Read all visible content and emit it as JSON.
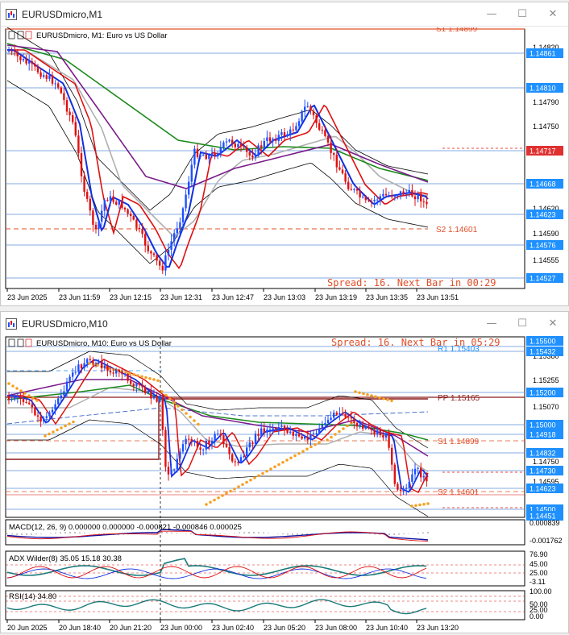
{
  "windows": [
    {
      "title": "EURUSDmicro,M1",
      "header": "EURUSDmicro, M1:  Euro vs US Dollar",
      "spread": "Spread: 16. Next Bar in 00:29",
      "price_labels": [
        "1.14820",
        "1.14790",
        "1.14750",
        "1.14717",
        "1.14620",
        "1.14590",
        "1.14555"
      ],
      "price_boxes": [
        {
          "text": "1.14861",
          "color": "#1e90ff"
        },
        {
          "text": "1.14810",
          "color": "#1e90ff"
        },
        {
          "text": "1.14717",
          "color": "#e03030"
        },
        {
          "text": "1.14668",
          "color": "#1e90ff"
        },
        {
          "text": "1.14623",
          "color": "#1e90ff"
        },
        {
          "text": "1.14576",
          "color": "#1e90ff"
        },
        {
          "text": "1.14527",
          "color": "#1e90ff"
        }
      ],
      "levels": [
        {
          "text": "S1 1.14899",
          "color": "#e0502a"
        },
        {
          "text": "S2 1.14601",
          "color": "#e0502a"
        }
      ],
      "time_labels": [
        "23 Jun 2025",
        "23 Jun 11:59",
        "23 Jun 12:15",
        "23 Jun 12:31",
        "23 Jun 12:47",
        "23 Jun 13:03",
        "23 Jun 13:19",
        "23 Jun 13:35",
        "23 Jun 13:51"
      ]
    },
    {
      "title": "EURUSDmicro,M10",
      "header": "EURUSDmicro, M10:  Euro vs US Dollar",
      "spread": "Spread: 16. Next Bar in 05:29",
      "price_labels": [
        "1.15380",
        "1.15255",
        "1.15070",
        "1.14915",
        "1.14750",
        "1.14595"
      ],
      "price_boxes": [
        {
          "text": "1.15500",
          "color": "#1e90ff"
        },
        {
          "text": "1.15432",
          "color": "#1e90ff"
        },
        {
          "text": "1.15200",
          "color": "#1e90ff"
        },
        {
          "text": "1.15000",
          "color": "#1e90ff"
        },
        {
          "text": "1.14918",
          "color": "#1e90ff"
        },
        {
          "text": "1.14832",
          "color": "#1e90ff"
        },
        {
          "text": "1.14730",
          "color": "#1e90ff"
        },
        {
          "text": "1.14623",
          "color": "#1e90ff"
        },
        {
          "text": "1.14500",
          "color": "#1e90ff"
        },
        {
          "text": "1.14451",
          "color": "#1e90ff"
        }
      ],
      "levels": [
        {
          "text": "R1 1.15403",
          "color": "#1e90ff"
        },
        {
          "text": "PP 1.15165",
          "color": "#8b1a1a"
        },
        {
          "text": "S1 1.14899",
          "color": "#e0502a"
        },
        {
          "text": "S2 1.14601",
          "color": "#e0502a"
        }
      ],
      "time_labels": [
        "20 Jun 2025",
        "20 Jun 18:40",
        "20 Jun 21:20",
        "23 Jun 00:00",
        "23 Jun 02:40",
        "23 Jun 05:20",
        "23 Jun 08:00",
        "23 Jun 10:40",
        "23 Jun 13:20"
      ],
      "indicators": [
        {
          "name": "MACD(12, 26, 9) 0.000000 0.000000 -0.000821 -0.000846 0.000025",
          "scale": [
            "0.000839",
            "-0.001762"
          ]
        },
        {
          "name": "ADX Wilder(8) 35.05 15.18 30.38",
          "scale": [
            "76.90",
            "45.00",
            "25.00",
            "-3.11"
          ]
        },
        {
          "name": "RSI(14) 34.80",
          "scale": [
            "100.00",
            "50.00",
            "25.00",
            "0.00"
          ]
        }
      ]
    }
  ],
  "window_controls": {
    "minimize": "—",
    "maximize": "☐",
    "close": "✕"
  },
  "colors": {
    "bull_candle": "#1e50ff",
    "bear_candle": "#e01010",
    "ma_blue": "#1030e0",
    "ma_red": "#e01010",
    "ma_purple": "#7a1a8a",
    "ma_green": "#1a8a1a",
    "ma_grey": "#b0b0b0",
    "sar": "#f5a020",
    "macd_line": "#1010a0",
    "macd_signal": "#e01010",
    "adx_line": "#1a7a7a"
  }
}
